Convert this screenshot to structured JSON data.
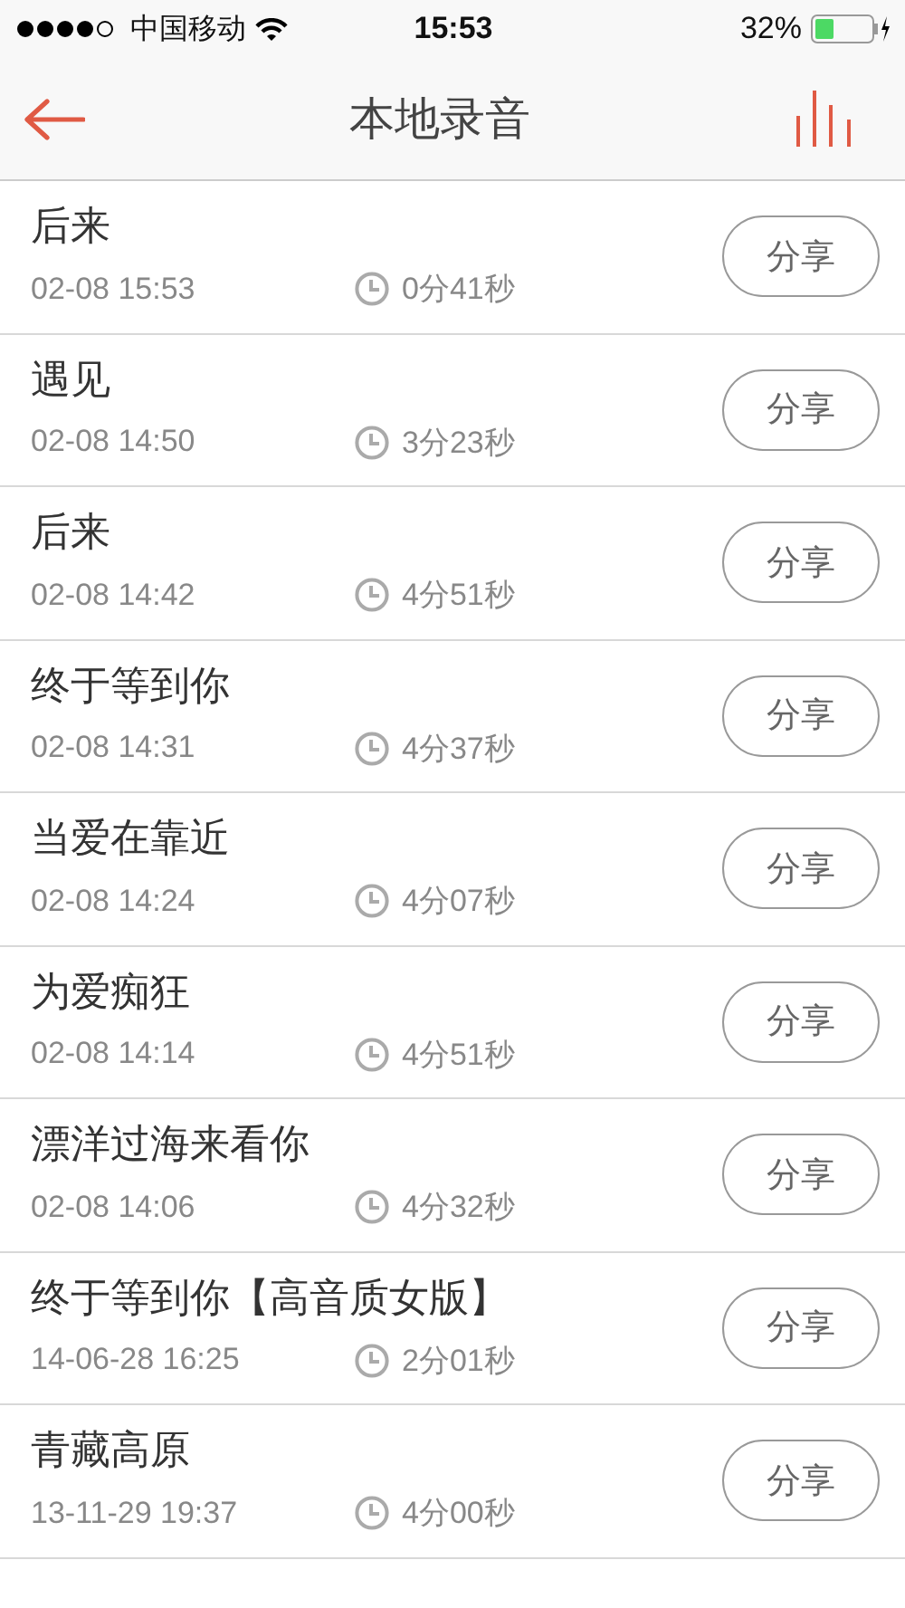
{
  "status_bar": {
    "carrier": "中国移动",
    "time": "15:53",
    "battery": "32%"
  },
  "nav": {
    "title": "本地录音"
  },
  "recordings": [
    {
      "title": "后来",
      "date": "02-08 15:53",
      "duration": "0分41秒",
      "action": "分享"
    },
    {
      "title": "遇见",
      "date": "02-08 14:50",
      "duration": "3分23秒",
      "action": "分享"
    },
    {
      "title": "后来",
      "date": "02-08 14:42",
      "duration": "4分51秒",
      "action": "分享"
    },
    {
      "title": "终于等到你",
      "date": "02-08 14:31",
      "duration": "4分37秒",
      "action": "分享"
    },
    {
      "title": "当爱在靠近",
      "date": "02-08 14:24",
      "duration": "4分07秒",
      "action": "分享"
    },
    {
      "title": "为爱痴狂",
      "date": "02-08 14:14",
      "duration": "4分51秒",
      "action": "分享"
    },
    {
      "title": "漂洋过海来看你",
      "date": "02-08 14:06",
      "duration": "4分32秒",
      "action": "分享"
    },
    {
      "title": "终于等到你【高音质女版】",
      "date": "14-06-28 16:25",
      "duration": "2分01秒",
      "action": "分享"
    },
    {
      "title": "青藏高原",
      "date": "13-11-29 19:37",
      "duration": "4分00秒",
      "action": "分享"
    }
  ]
}
